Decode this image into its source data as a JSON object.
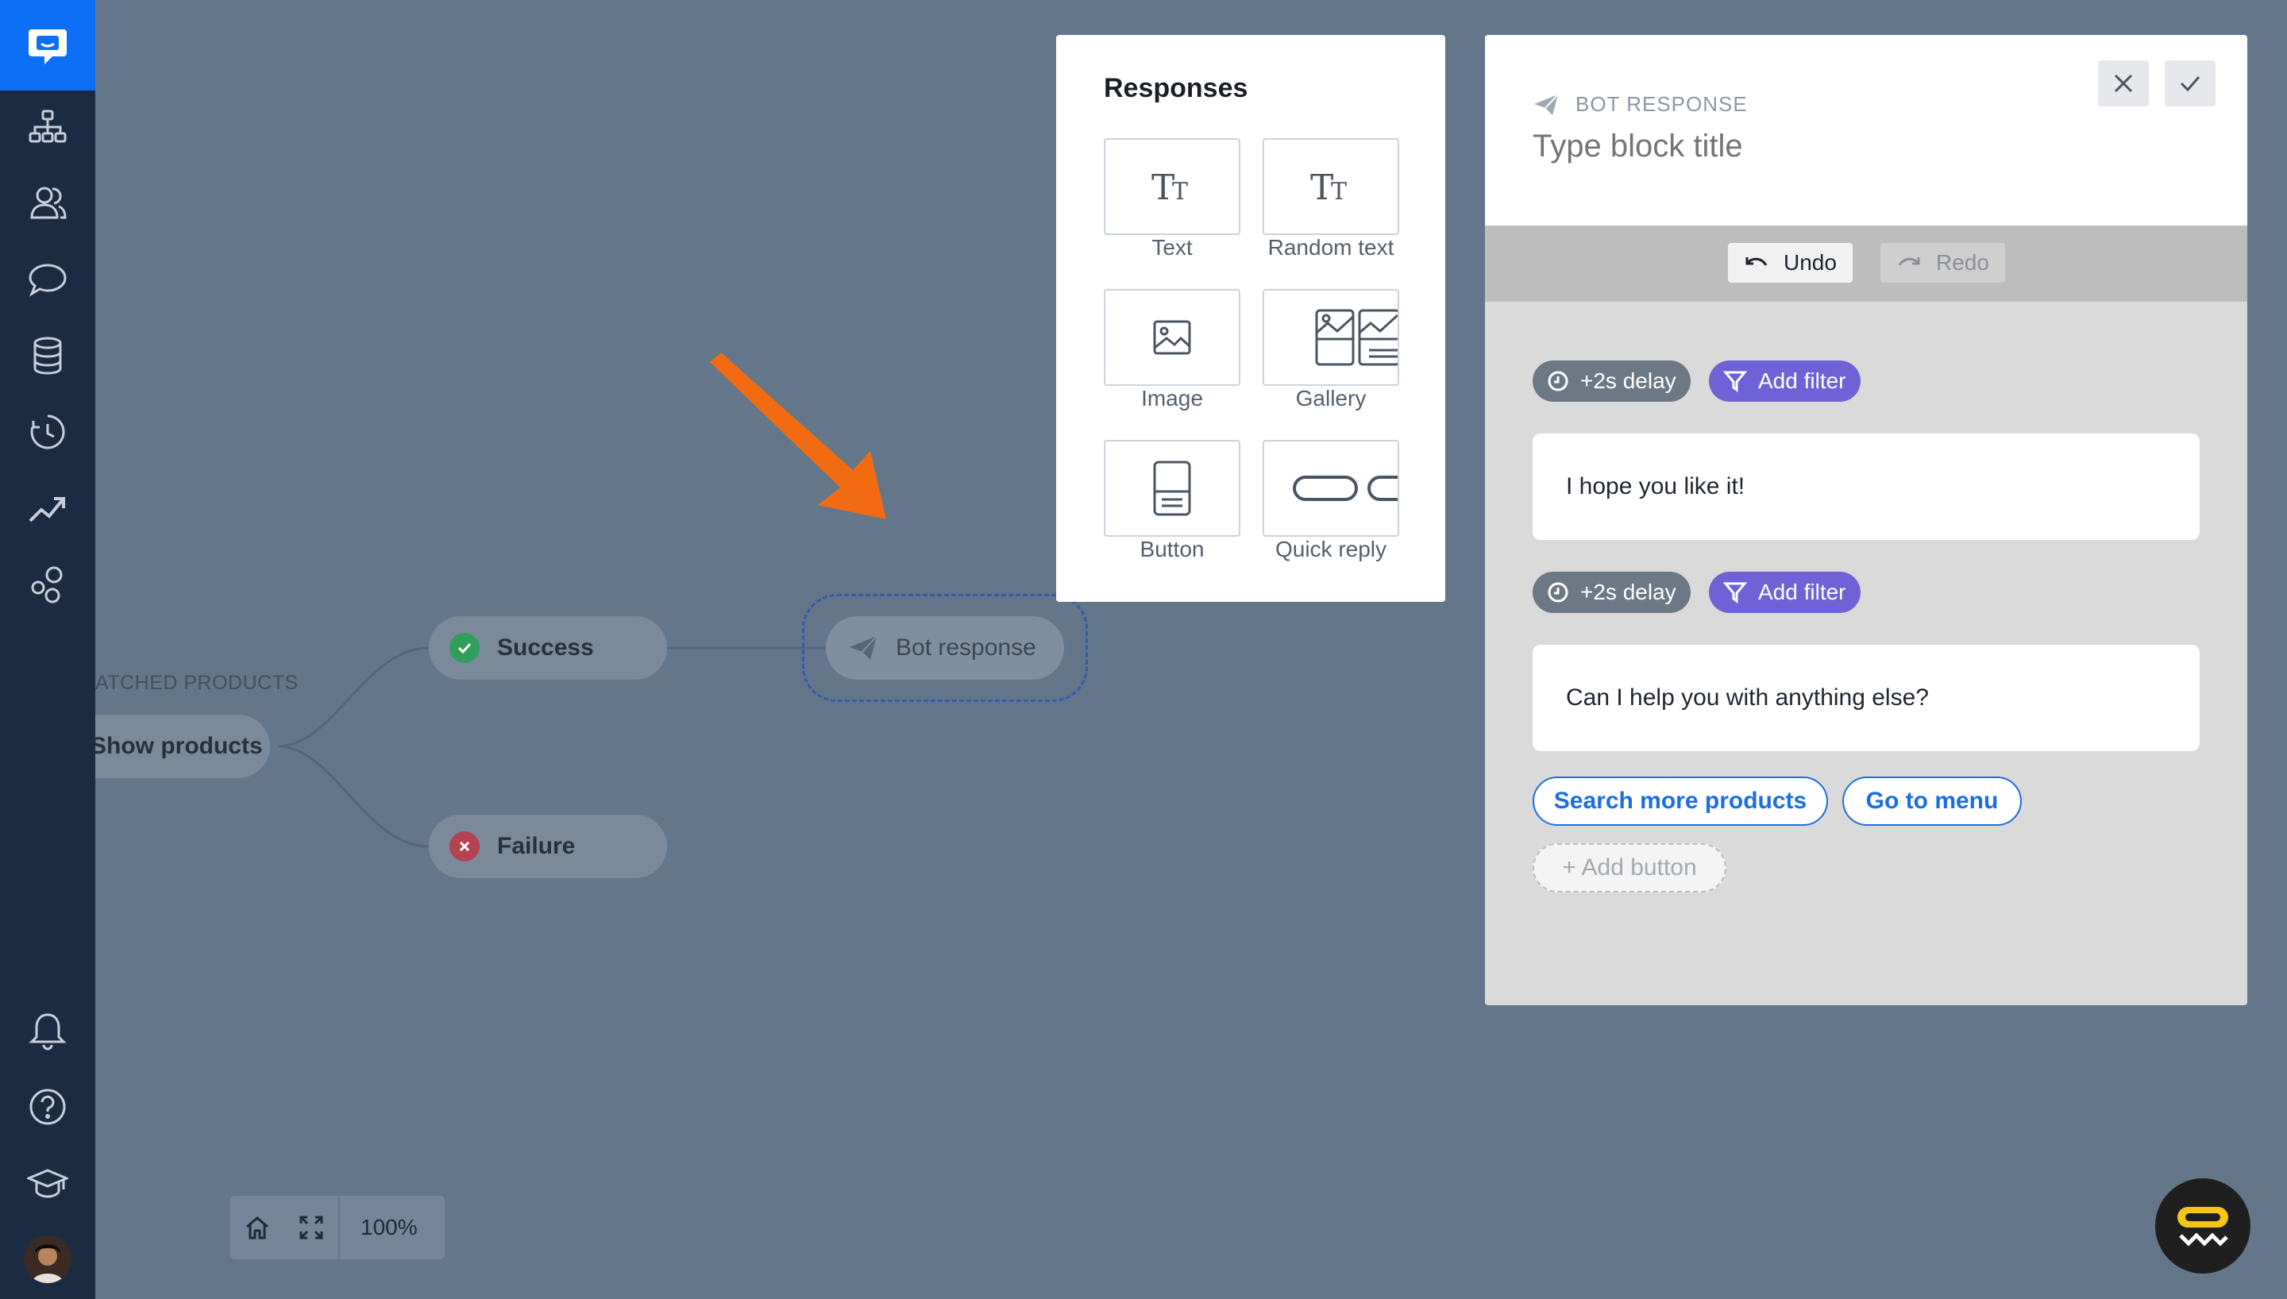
{
  "sidebar": {
    "items": [
      {
        "name": "flows"
      },
      {
        "name": "audience"
      },
      {
        "name": "chats"
      },
      {
        "name": "data"
      },
      {
        "name": "history"
      },
      {
        "name": "reports"
      },
      {
        "name": "integrations"
      }
    ],
    "bottom": [
      {
        "name": "notifications"
      },
      {
        "name": "help"
      },
      {
        "name": "academy"
      }
    ]
  },
  "canvas": {
    "caption": "ATCHED PRODUCTS",
    "source_node": "Show products",
    "success_node": "Success",
    "failure_node": "Failure",
    "bot_node": "Bot response",
    "zoom": "100%"
  },
  "responses": {
    "title": "Responses",
    "tiles": [
      {
        "label": "Text",
        "icon": "text-icon"
      },
      {
        "label": "Random text",
        "icon": "random-text-icon"
      },
      {
        "label": "Image",
        "icon": "image-icon"
      },
      {
        "label": "Gallery",
        "icon": "gallery-icon"
      },
      {
        "label": "Button",
        "icon": "button-icon"
      },
      {
        "label": "Quick reply",
        "icon": "quick-reply-icon"
      }
    ]
  },
  "bot_panel": {
    "kicker": "BOT RESPONSE",
    "title_placeholder": "Type block title",
    "undo": "Undo",
    "redo": "Redo",
    "blocks": [
      {
        "delay": "+2s delay",
        "filter": "Add filter",
        "message": "I hope you like it!"
      },
      {
        "delay": "+2s delay",
        "filter": "Add filter",
        "message": "Can I help you with anything else?"
      }
    ],
    "quick_buttons": [
      "Search more products",
      "Go to menu"
    ],
    "add_button": "+ Add button"
  },
  "colors": {
    "sidebar": "#1b2c42",
    "brand": "#0c6ff6",
    "canvas": "#647689",
    "filter": "#6e62d6",
    "link": "#1a6fe0",
    "arrow": "#f26b12"
  }
}
